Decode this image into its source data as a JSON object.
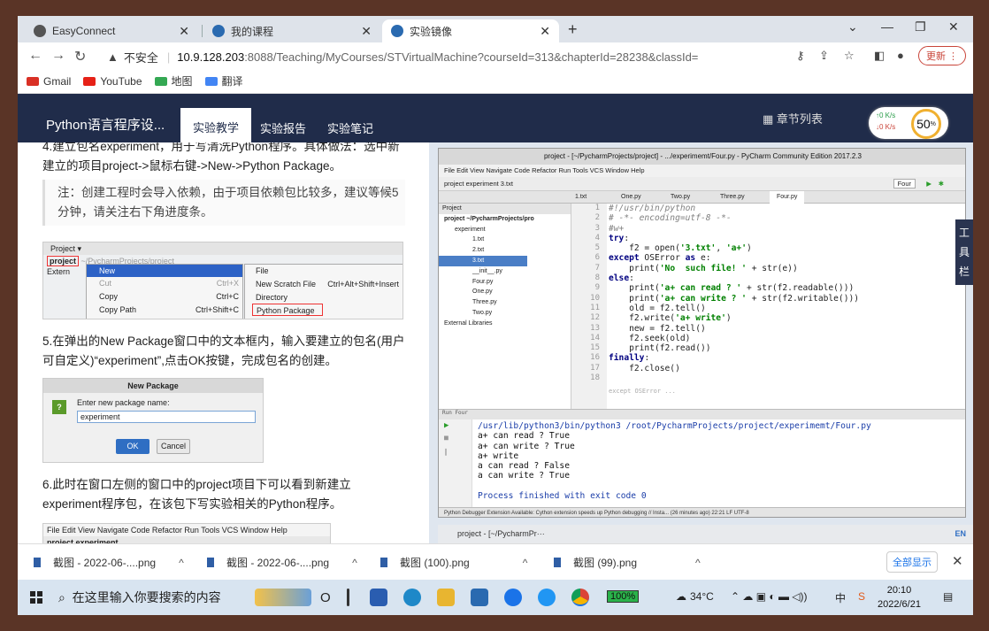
{
  "browser": {
    "tabs": [
      {
        "label": "EasyConnect"
      },
      {
        "label": "我的课程"
      },
      {
        "label": "实验镜像"
      }
    ],
    "url_warning": "不安全",
    "url_host": "10.9.128.203",
    "url_path": ":8088/Teaching/MyCourses/STVirtualMachine?courseId=313&chapterId=28238&classId=",
    "update_label": "更新",
    "bookmarks": [
      "Gmail",
      "YouTube",
      "地图",
      "翻译"
    ]
  },
  "site": {
    "brand": "Python语言程序设...",
    "nav": [
      "实验教学",
      "实验报告",
      "实验笔记"
    ],
    "chapter_list": "章节列表",
    "speed_up": "0 K/s",
    "speed_down": "0 K/s",
    "speed_pct": "50",
    "toolbox": [
      "工",
      "具",
      "栏"
    ]
  },
  "doc": {
    "step4": "4.建立包名experiment，用于写清洗Python程序。具体做法：选中新建立的项目project->鼠标右键->New->Python Package。",
    "note": "注：创建工程时会导入依赖，由于项目依赖包比较多，建议等候5分钟，请关注右下角进度条。",
    "menu_shot": {
      "tool": "Project",
      "project": "project",
      "project_path": "~/PycharmProjects/project",
      "external": "Extern",
      "items_left": [
        "New",
        "Cut",
        "Copy",
        "Copy Path"
      ],
      "shortcuts": [
        "Ctrl+X",
        "Ctrl+C",
        "Ctrl+Shift+C"
      ],
      "items_right": [
        "File",
        "New Scratch File",
        "Directory",
        "Python Package"
      ],
      "scratch_shortcut": "Ctrl+Alt+Shift+Insert"
    },
    "step5": "5.在弹出的New Package窗口中的文本框内，输入要建立的包名(用户可自定义)“experiment”,点击OK按键，完成包名的创建。",
    "dialog": {
      "title": "New Package",
      "prompt": "Enter new package name:",
      "value": "experiment",
      "ok": "OK",
      "cancel": "Cancel"
    },
    "step6": "6.此时在窗口左侧的窗口中的project项目下可以看到新建立experiment程序包，在该包下写实验相关的Python程序。",
    "mini_menu": "File  Edit  View  Navigate  Code  Refactor  Run  Tools  VCS  Window  Help",
    "mini_crumb": "project  experiment"
  },
  "ide": {
    "title": "project - [~/PycharmProjects/project] - .../experimemt/Four.py - PyCharm Community Edition 2017.2.3",
    "menu": "File  Edit  View  Navigate  Code  Refactor  Run  Tools  VCS  Window  Help",
    "crumb": "project  experiment  3.txt",
    "run_config": "Four",
    "tabs": [
      "1.txt",
      "One.py",
      "Two.py",
      "Three.py",
      "Four.py"
    ],
    "tree": [
      "Project",
      "project  ~/PycharmProjects/pro",
      "experiment",
      "1.txt",
      "2.txt",
      "3.txt",
      "__init__.py",
      "Four.py",
      "One.py",
      "Three.py",
      "Two.py",
      "External Libraries"
    ],
    "code": [
      "#!/usr/bin/python",
      "# -*- encoding=utf-8 -*-",
      "#w+",
      "try:",
      "    f2 = open('3.txt', 'a+')",
      "except OSError as e:",
      "    print('No  such file! ' + str(e))",
      "else:",
      "    print('a+ can read ? ' + str(f2.readable()))",
      "    print('a+ can write ? ' + str(f2.writable()))",
      "    old = f2.tell()",
      "    f2.write('a+ write')",
      "    new = f2.tell()",
      "    f2.seek(old)",
      "    print(f2.read())",
      "finally:",
      "    f2.close()",
      ""
    ],
    "code_footer": "except OSError ...",
    "run_header": "Run  Four",
    "output": [
      "/usr/lib/python3/bin/python3 /root/PycharmProjects/project/experimemt/Four.py",
      "a+ can read ? True",
      "a+ can write ? True",
      "a+ write",
      "a can read ? False",
      "a can write ? True",
      "",
      "Process finished with exit code 0"
    ],
    "status": "Python Debugger Extension Available: Cython extension speeds up Python debugging // Insta... (26 minutes ago)  22:21  LF  UTF-8",
    "vm_task": "project - [~/PycharmPr···",
    "vm_lang": "EN"
  },
  "downloads": {
    "items": [
      "截图 - 2022-06-....png",
      "截图 - 2022-06-....png",
      "截图 (100).png",
      "截图 (99).png"
    ],
    "show_all": "全部显示"
  },
  "taskbar": {
    "search": "在这里输入你要搜索的内容",
    "battery": "100%",
    "weather": "34°C",
    "ime": "中",
    "time": "20:10",
    "date": "2022/6/21"
  }
}
